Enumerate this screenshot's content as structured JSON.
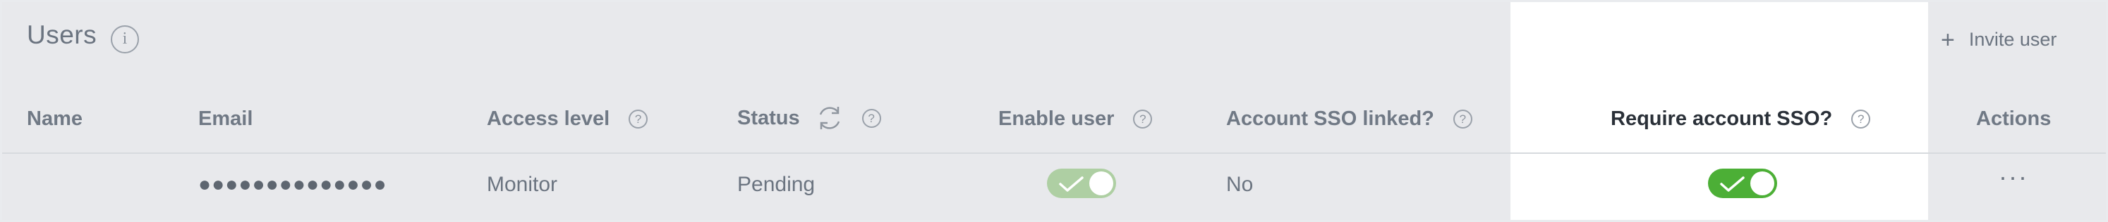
{
  "header": {
    "title": "Users",
    "info_icon": "i",
    "invite_label": "Invite user",
    "invite_icon": "plus-icon"
  },
  "columns": {
    "name": "Name",
    "email": "Email",
    "access_level": "Access level",
    "status": "Status",
    "enable_user": "Enable user",
    "account_sso_linked": "Account SSO linked?",
    "require_account_sso": "Require account SSO?",
    "actions": "Actions",
    "help_glyph": "?"
  },
  "rows": [
    {
      "name": "",
      "email": "●●●●●●●●●●●●●●",
      "access_level": "Monitor",
      "status": "Pending",
      "enable_user": true,
      "enable_user_disabled": true,
      "account_sso_linked": "No",
      "require_account_sso": true,
      "actions": "···"
    }
  ],
  "colors": {
    "toggle_on": "#4caf36",
    "toggle_disabled": "#aecfa3",
    "highlight_column": "#ffffff"
  }
}
